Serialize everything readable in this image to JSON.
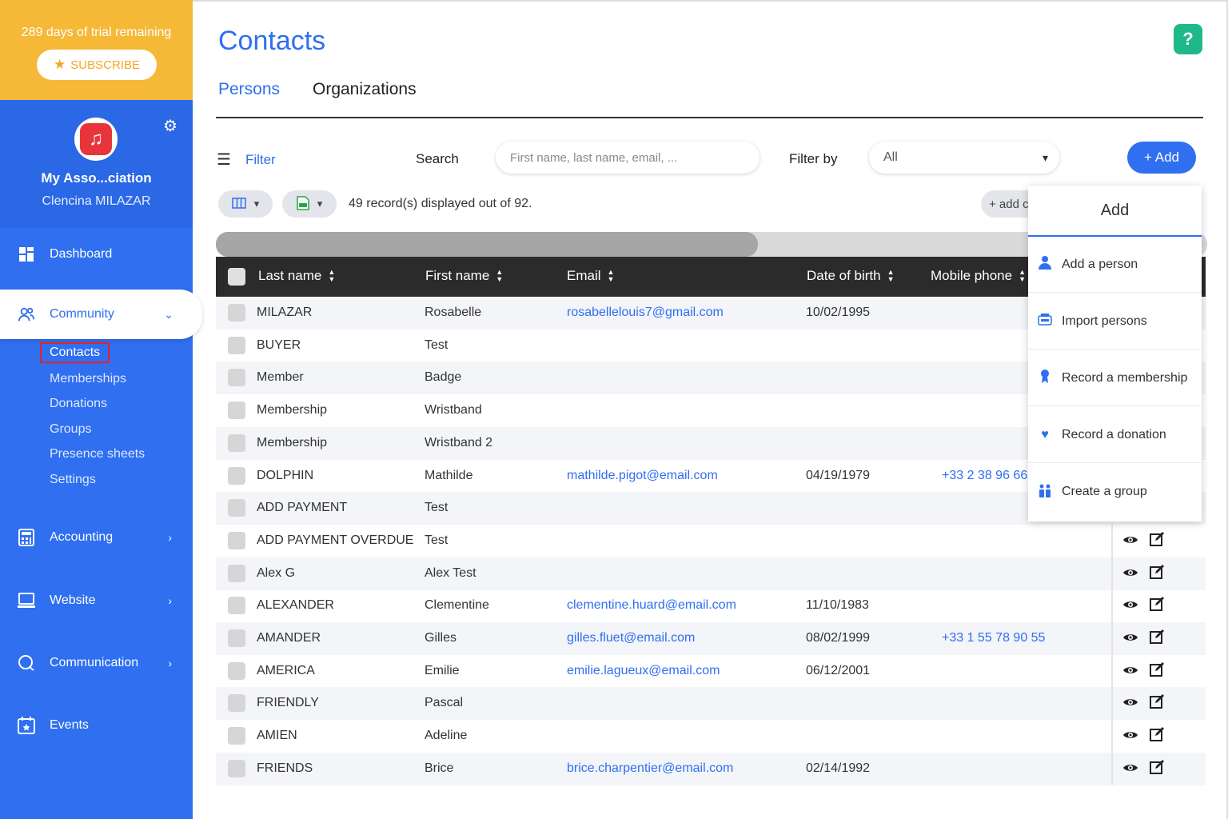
{
  "trial": {
    "text": "289 days of trial remaining",
    "subscribe": "SUBSCRIBE"
  },
  "org": {
    "name": "My Asso...ciation",
    "user": "Clencina MILAZAR"
  },
  "nav": {
    "dashboard": "Dashboard",
    "community": "Community",
    "community_sub": [
      "Contacts",
      "Memberships",
      "Donations",
      "Groups",
      "Presence sheets",
      "Settings"
    ],
    "accounting": "Accounting",
    "website": "Website",
    "communication": "Communication",
    "events": "Events"
  },
  "page": {
    "title": "Contacts",
    "tabs": [
      "Persons",
      "Organizations"
    ],
    "help": "?"
  },
  "toolbar": {
    "filter": "Filter",
    "search_label": "Search",
    "search_placeholder": "First name, last name, email, ...",
    "filter_by_label": "Filter by",
    "filter_by_value": "All",
    "add": "+ Add",
    "records_text": "49 record(s) displayed out of 92.",
    "add_column": "+ add c"
  },
  "table": {
    "headers": [
      "Last name",
      "First name",
      "Email",
      "Date of birth",
      "Mobile phone"
    ],
    "rows": [
      {
        "last": "MILAZAR",
        "first": "Rosabelle",
        "email": "rosabellelouis7@gmail.com",
        "dob": "10/02/1995",
        "phone": ""
      },
      {
        "last": "BUYER",
        "first": "Test",
        "email": "",
        "dob": "",
        "phone": ""
      },
      {
        "last": "Member",
        "first": "Badge",
        "email": "",
        "dob": "",
        "phone": ""
      },
      {
        "last": "Membership",
        "first": "Wristband",
        "email": "",
        "dob": "",
        "phone": ""
      },
      {
        "last": "Membership",
        "first": "Wristband 2",
        "email": "",
        "dob": "",
        "phone": ""
      },
      {
        "last": "DOLPHIN",
        "first": "Mathilde",
        "email": "mathilde.pigot@email.com",
        "dob": "04/19/1979",
        "phone": "+33 2 38 96 66"
      },
      {
        "last": "ADD PAYMENT",
        "first": "Test",
        "email": "",
        "dob": "",
        "phone": ""
      },
      {
        "last": "ADD PAYMENT OVERDUE",
        "first": "Test",
        "email": "",
        "dob": "",
        "phone": ""
      },
      {
        "last": "Alex G",
        "first": "Alex Test",
        "email": "",
        "dob": "",
        "phone": ""
      },
      {
        "last": "ALEXANDER",
        "first": "Clementine",
        "email": "clementine.huard@email.com",
        "dob": "11/10/1983",
        "phone": ""
      },
      {
        "last": "AMANDER",
        "first": "Gilles",
        "email": "gilles.fluet@email.com",
        "dob": "08/02/1999",
        "phone": "+33 1 55 78 90 55"
      },
      {
        "last": "AMERICA",
        "first": "Emilie",
        "email": "emilie.lagueux@email.com",
        "dob": "06/12/2001",
        "phone": ""
      },
      {
        "last": "FRIENDLY",
        "first": "Pascal",
        "email": "",
        "dob": "",
        "phone": ""
      },
      {
        "last": "AMIEN",
        "first": "Adeline",
        "email": "",
        "dob": "",
        "phone": ""
      },
      {
        "last": "FRIENDS",
        "first": "Brice",
        "email": "brice.charpentier@email.com",
        "dob": "02/14/1992",
        "phone": ""
      }
    ]
  },
  "dropdown": {
    "title": "Add",
    "items": [
      "Add a person",
      "Import persons",
      "Record a membership",
      "Record a donation",
      "Create a group"
    ]
  },
  "colors": {
    "primary": "#2f6ff0",
    "trial": "#f5b937",
    "help": "#1fb88a",
    "highlight": "#e0252b"
  },
  "icons": [
    "star-icon",
    "music-icon",
    "gear-icon",
    "dashboard-icon",
    "community-icon",
    "accounting-icon",
    "website-icon",
    "communication-icon",
    "events-icon",
    "menu-icon",
    "chevron-down-icon",
    "columns-icon",
    "excel-icon",
    "sort-icon",
    "eye-icon",
    "edit-icon",
    "person-icon",
    "import-icon",
    "ribbon-icon",
    "heart-icon",
    "group-icon"
  ]
}
